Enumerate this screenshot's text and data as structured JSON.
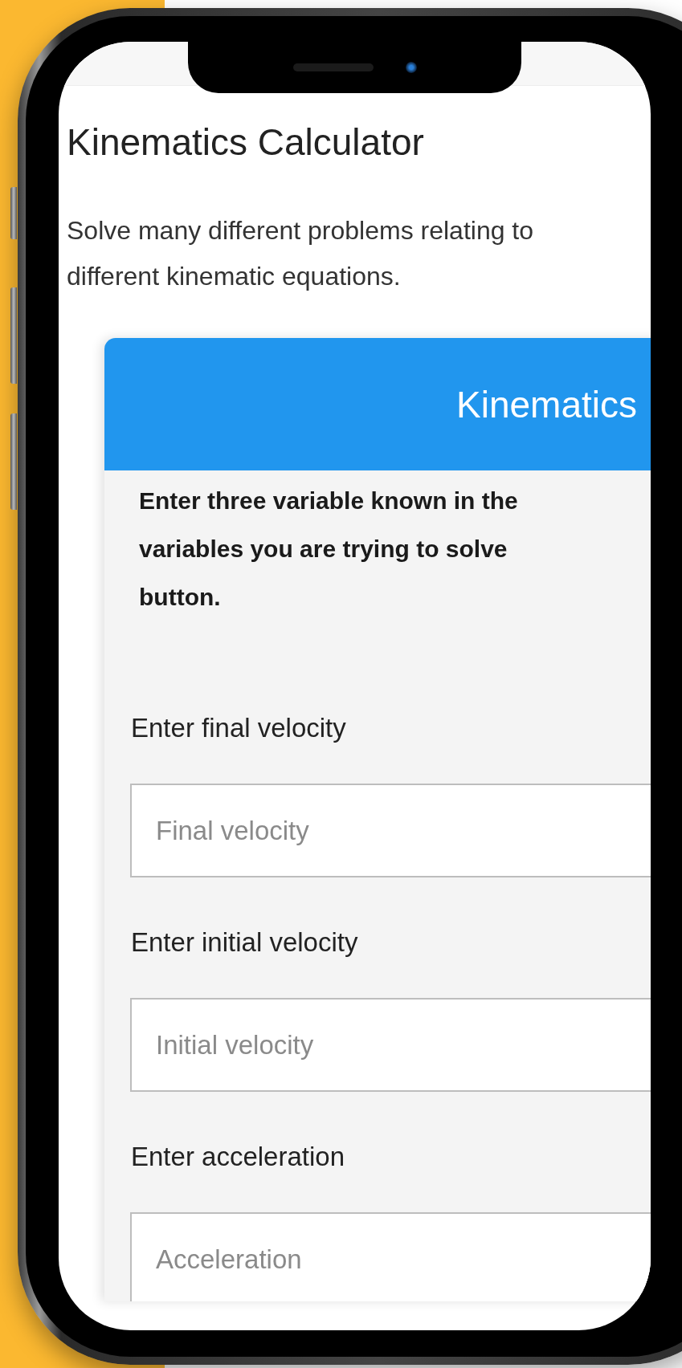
{
  "page": {
    "title": "Kinematics Calculator",
    "intro": [
      "Solve many different problems relating to",
      "different kinematic equations."
    ]
  },
  "calculator": {
    "title": "Kinematics",
    "instructions": [
      "Enter three variable known in the",
      "variables you are trying to solve",
      "button."
    ],
    "fields": [
      {
        "label": "Enter final velocity",
        "placeholder": "Final velocity"
      },
      {
        "label": "Enter initial velocity",
        "placeholder": "Initial velocity"
      },
      {
        "label": "Enter acceleration",
        "placeholder": "Acceleration"
      }
    ]
  }
}
